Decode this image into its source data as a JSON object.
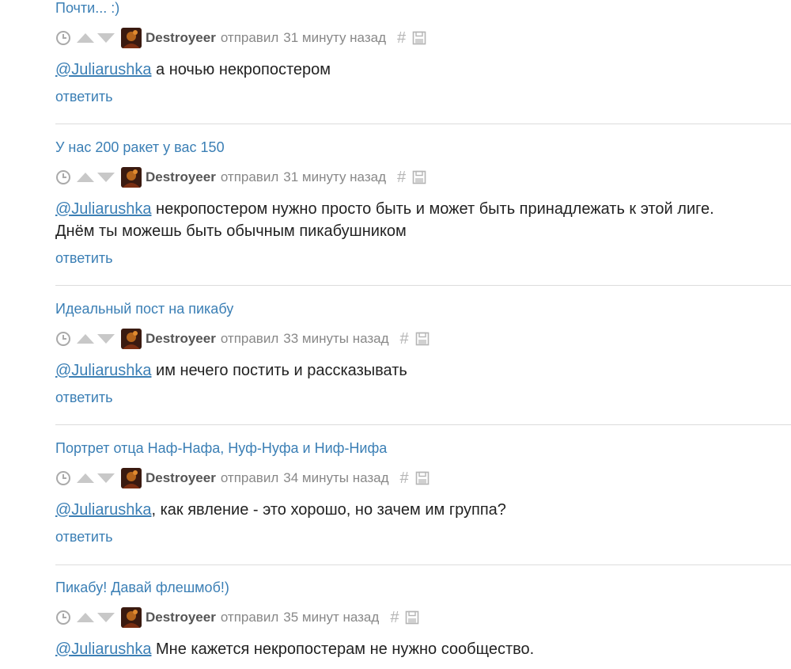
{
  "comments": [
    {
      "post_title": "Почти... :)",
      "author": "Destroyeer",
      "action": "отправил",
      "time": "31 минуту назад",
      "mention": "@Juliarushka",
      "text": " а ночью некропостером",
      "reply_label": "ответить"
    },
    {
      "post_title": "У нас 200 ракет у вас 150",
      "author": "Destroyeer",
      "action": "отправил",
      "time": "31 минуту назад",
      "mention": "@Juliarushka",
      "text": " некропостером нужно просто быть и может быть принадлежать к этой лиге. Днём ты можешь быть обычным пикабушником",
      "reply_label": "ответить"
    },
    {
      "post_title": "Идеальный пост на пикабу",
      "author": "Destroyeer",
      "action": "отправил",
      "time": "33 минуты назад",
      "mention": "@Juliarushka",
      "text": " им нечего постить и рассказывать",
      "reply_label": "ответить"
    },
    {
      "post_title": "Портрет отца Наф-Нафа, Нуф-Нуфа и Ниф-Нифа",
      "author": "Destroyeer",
      "action": "отправил",
      "time": "34 минуты назад",
      "mention": "@Juliarushka",
      "text": ", как явление - это хорошо, но зачем им группа?",
      "reply_label": "ответить"
    },
    {
      "post_title": "Пикабу! Давай флешмоб!)",
      "author": "Destroyeer",
      "action": "отправил",
      "time": "35 минут назад",
      "mention": "@Juliarushka",
      "text": " Мне кажется некропостерам не нужно сообщество.",
      "reply_label": ""
    }
  ],
  "icons": {
    "time": "clock-icon",
    "upvote": "arrow-up-icon",
    "downvote": "arrow-down-icon",
    "link": "hash-icon",
    "save": "save-icon"
  },
  "colors": {
    "link": "#3b7fb5",
    "separator": "#dcdcdc",
    "meta": "#888888",
    "author": "#555555"
  }
}
